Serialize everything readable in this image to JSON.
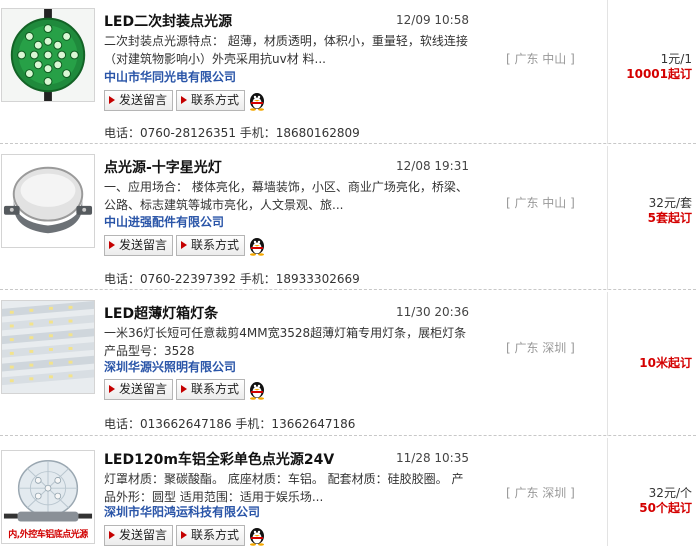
{
  "colors": {
    "company_link": "#2a55a8",
    "min_order": "#d40000",
    "region": "#999999"
  },
  "listings": [
    {
      "title": "LED二次封装点光源",
      "date": "12/09 10:58",
      "desc": "二次封装点光源特点： 超薄，材质透明，体积小，重量轻，软线连接（对建筑物影响小）外壳采用抗uv材 料...",
      "company": "中山市华同光电有限公司",
      "send_label": "发送留言",
      "contact_label": "联系方式",
      "phone": "电话：0760-28126351  手机：18680162809",
      "region": "[ 广东   中山 ]",
      "price": "1元/1",
      "min_order": "10001起订",
      "thumb_icon": "green-led-dot-light"
    },
    {
      "title": "点光源-十字星光灯",
      "date": "12/08 19:31",
      "desc": "一、应用场合： 楼体亮化，幕墙装饰，小区、商业广场亮化，桥梁、公路、标志建筑等城市亮化，人文景观、旅...",
      "company": "中山进强配件有限公司",
      "send_label": "发送留言",
      "contact_label": "联系方式",
      "phone": "电话：0760-22397392  手机：18933302669",
      "region": "[ 广东   中山 ]",
      "price": "32元/套",
      "min_order": "5套起订",
      "thumb_icon": "dome-point-light"
    },
    {
      "title": "LED超薄灯箱灯条",
      "date": "11/30 20:36",
      "desc": "一米36灯长短可任意裁剪4MM宽3528超薄灯箱专用灯条，展柜灯条 产品型号：3528",
      "company": "深圳华源兴照明有限公司",
      "send_label": "发送留言",
      "contact_label": "联系方式",
      "phone": "电话：013662647186  手机：13662647186",
      "region": "[ 广东   深圳 ]",
      "price": "",
      "min_order": "10米起订",
      "thumb_icon": "led-light-strips"
    },
    {
      "title": "LED120m车铝全彩单色点光源24V",
      "date": "11/28 10:35",
      "desc": "灯罩材质：聚碳酸酯。 底座材质：车铝。 配套材质：硅胶胶圈。 产品外形：圆型 适用范围：适用于娱乐场...",
      "company": "深圳市华阳鸿运科技有限公司",
      "send_label": "发送留言",
      "contact_label": "联系方式",
      "phone": "",
      "region": "[ 广东   深圳 ]",
      "price": "32元/个",
      "min_order": "50个起订",
      "thumb_icon": "crystal-dome-light",
      "thumb_caption": "内,外控车铝底点光源"
    }
  ]
}
